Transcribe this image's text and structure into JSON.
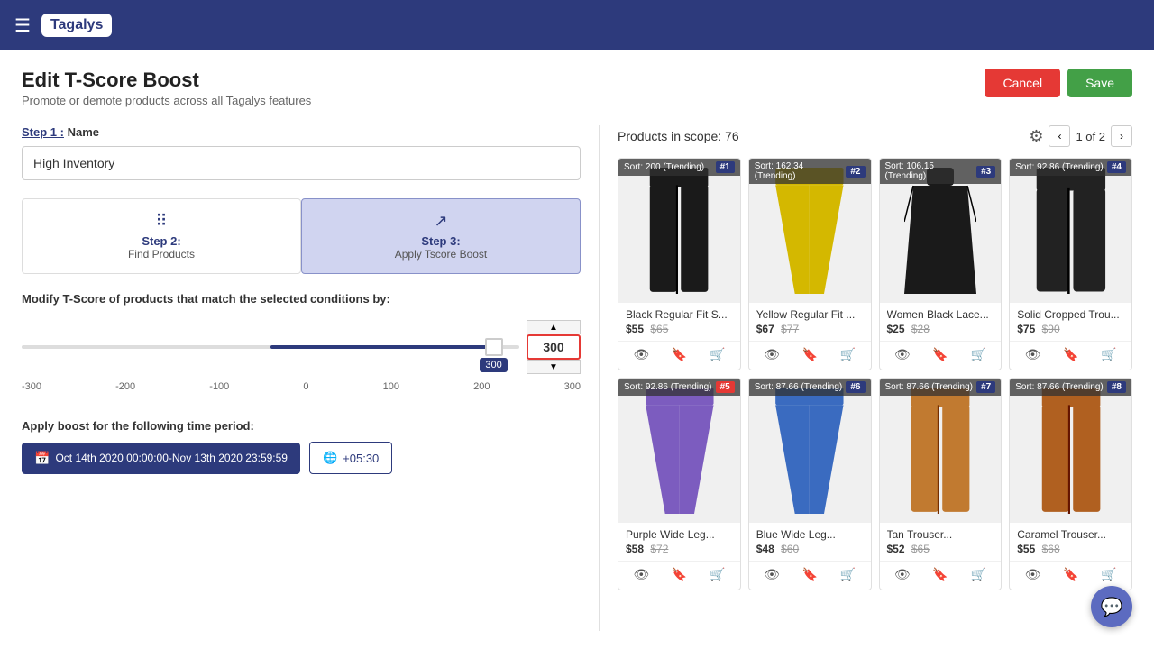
{
  "nav": {
    "hamburger": "☰",
    "logo": "Tagalys"
  },
  "header": {
    "title": "Edit T-Score Boost",
    "subtitle": "Promote or demote products across all Tagalys features",
    "cancel_label": "Cancel",
    "save_label": "Save"
  },
  "step1": {
    "label": "Step 1 :",
    "name": "Name",
    "input_value": "High Inventory",
    "input_placeholder": ""
  },
  "step2": {
    "label": "Step 2:",
    "name": "Find Products",
    "icon": "⠿"
  },
  "step3": {
    "label": "Step 3:",
    "name": "Apply Tscore Boost",
    "icon": "↗"
  },
  "modify": {
    "label": "Modify T-Score of products that match the selected conditions by:",
    "slider_min": -300,
    "slider_max": 300,
    "slider_value": 300,
    "ticks": [
      "-300",
      "-200",
      "-100",
      "0",
      "100",
      "200",
      "300"
    ]
  },
  "time_period": {
    "label": "Apply boost for the following time period:",
    "date_range": "Oct 14th 2020 00:00:00-Nov 13th 2020 23:59:59",
    "timezone": "+05:30"
  },
  "products": {
    "scope_label": "Products in scope:",
    "scope_count": "76",
    "pagination": "1 of 2",
    "items": [
      {
        "sort": "Sort: 200 (Trending)",
        "rank": "#1",
        "name": "Black Regular Fit S...",
        "price_current": "$55",
        "price_original": "$65",
        "color": "#1a1a1a",
        "shape": "pants"
      },
      {
        "sort": "Sort: 162.34 (Trending)",
        "rank": "#2",
        "name": "Yellow Regular Fit ...",
        "price_current": "$67",
        "price_original": "$77",
        "color": "#d4b800",
        "shape": "pants_wide"
      },
      {
        "sort": "Sort: 106.15 (Trending)",
        "rank": "#3",
        "name": "Women Black Lace...",
        "price_current": "$25",
        "price_original": "$28",
        "color": "#1a1a1a",
        "shape": "dress"
      },
      {
        "sort": "Sort: 92.86 (Trending)",
        "rank": "#4",
        "name": "Solid Cropped Trou...",
        "price_current": "$75",
        "price_original": "$90",
        "color": "#222",
        "shape": "pants_crop"
      },
      {
        "sort": "Sort: 92.86 (Trending)",
        "rank": "#5",
        "rank_color": "#e53935",
        "name": "Purple Wide Leg...",
        "price_current": "$58",
        "price_original": "$72",
        "color": "#7c5cbf",
        "shape": "pants_wide"
      },
      {
        "sort": "Sort: 87.66 (Trending)",
        "rank": "#6",
        "name": "Blue Wide Leg...",
        "price_current": "$48",
        "price_original": "$60",
        "color": "#3a6bc0",
        "shape": "pants_wide"
      },
      {
        "sort": "Sort: 87.66 (Trending)",
        "rank": "#7",
        "name": "Tan Trouser...",
        "price_current": "$52",
        "price_original": "$65",
        "color": "#c17a30",
        "shape": "pants"
      },
      {
        "sort": "Sort: 87.66 (Trending)",
        "rank": "#8",
        "name": "Caramel Trouser...",
        "price_current": "$55",
        "price_original": "$68",
        "color": "#b06020",
        "shape": "pants"
      }
    ]
  }
}
